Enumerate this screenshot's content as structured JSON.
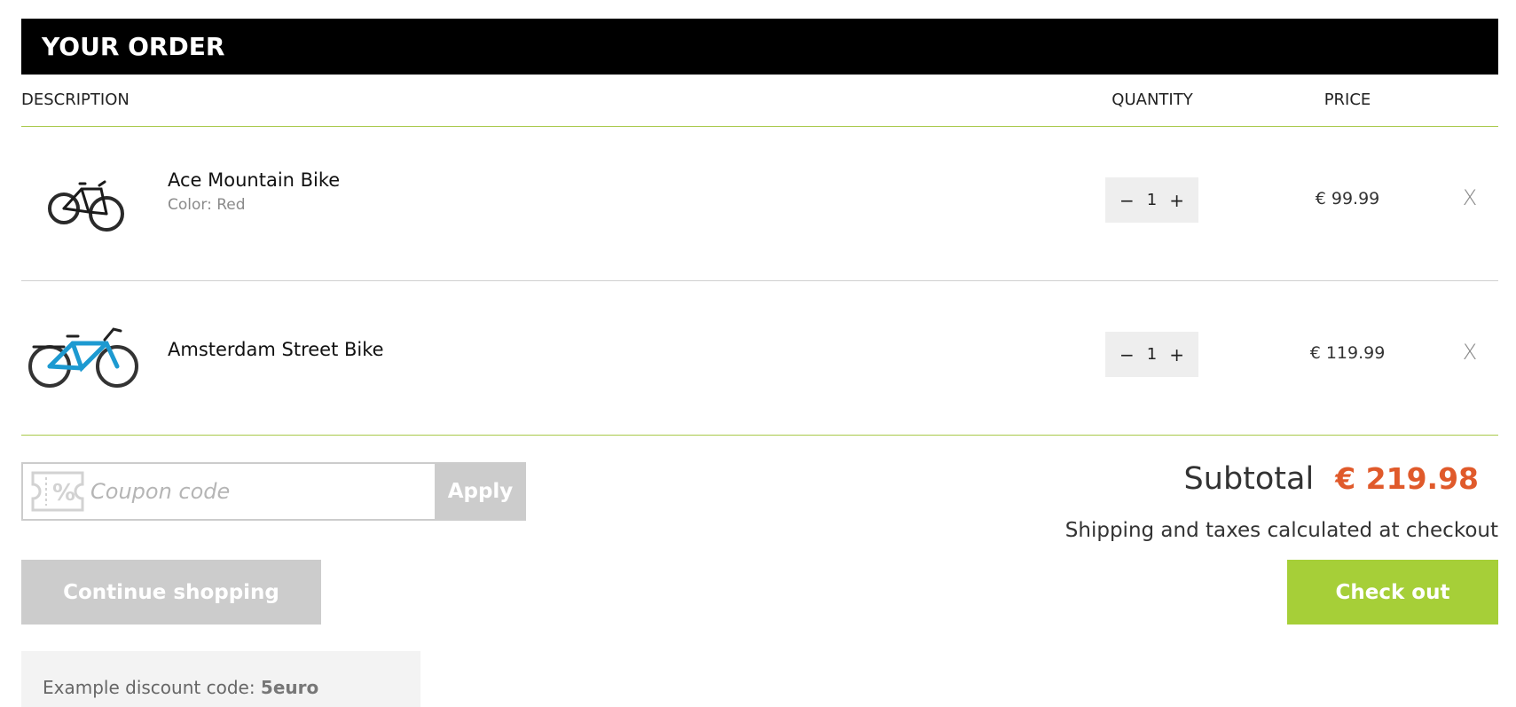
{
  "header": {
    "title": "YOUR ORDER"
  },
  "columns": {
    "description": "DESCRIPTION",
    "quantity": "QUANTITY",
    "price": "PRICE"
  },
  "items": [
    {
      "name": "Ace Mountain Bike",
      "variant": "Color: Red",
      "quantity": "1",
      "price": "€ 99.99",
      "image_icon": "mountain-bike-image",
      "frame_color": "#2a2a2a"
    },
    {
      "name": "Amsterdam Street Bike",
      "variant": "",
      "quantity": "1",
      "price": "€ 119.99",
      "image_icon": "street-bike-image",
      "frame_color": "#1d9ad1"
    }
  ],
  "qty_controls": {
    "minus": "−",
    "plus": "+"
  },
  "remove_label": "X",
  "coupon": {
    "placeholder": "Coupon code",
    "value": "",
    "apply_label": "Apply"
  },
  "summary": {
    "subtotal_label": "Subtotal",
    "subtotal_value": "€ 219.98",
    "shipping_note": "Shipping and taxes calculated at checkout"
  },
  "actions": {
    "continue_label": "Continue shopping",
    "checkout_label": "Check out"
  },
  "discount": {
    "prefix": "Example discount code: ",
    "code": "5euro"
  },
  "colors": {
    "accent_green": "#a6cf38",
    "price_orange": "#e05a2b",
    "header_black": "#000000",
    "button_gray": "#cccccc"
  }
}
